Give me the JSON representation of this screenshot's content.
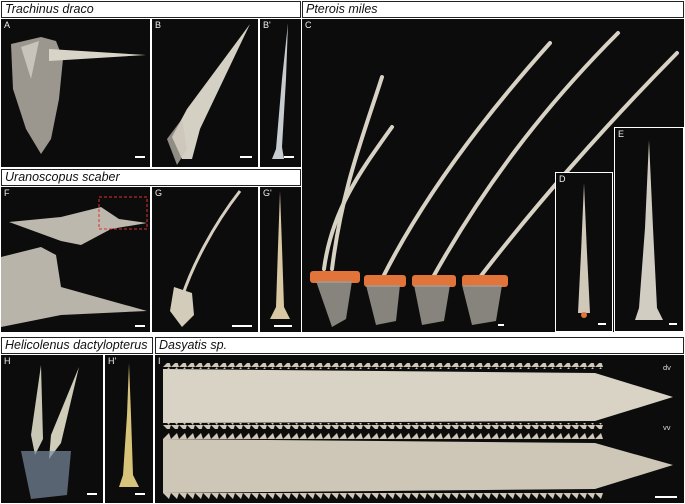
{
  "sections": {
    "trachinus": "Trachinus draco",
    "pterois": "Pterois miles",
    "uranoscopus": "Uranoscopus scaber",
    "helicolenus": "Helicolenus dactylopterus",
    "dasyatis": "Dasyatis sp."
  },
  "panels": {
    "A": "A",
    "B": "B",
    "B2": "B'",
    "C": "C",
    "D": "D",
    "E": "E",
    "F": "F",
    "G": "G",
    "G2": "G'",
    "H": "H",
    "H2": "H'",
    "I": "I"
  },
  "stingray_views": {
    "dorsal": "dv",
    "ventral": "vv"
  },
  "colors": {
    "background": "#0c0c0c",
    "bone": "#d8d2c4",
    "tissue": "#e2743a"
  }
}
